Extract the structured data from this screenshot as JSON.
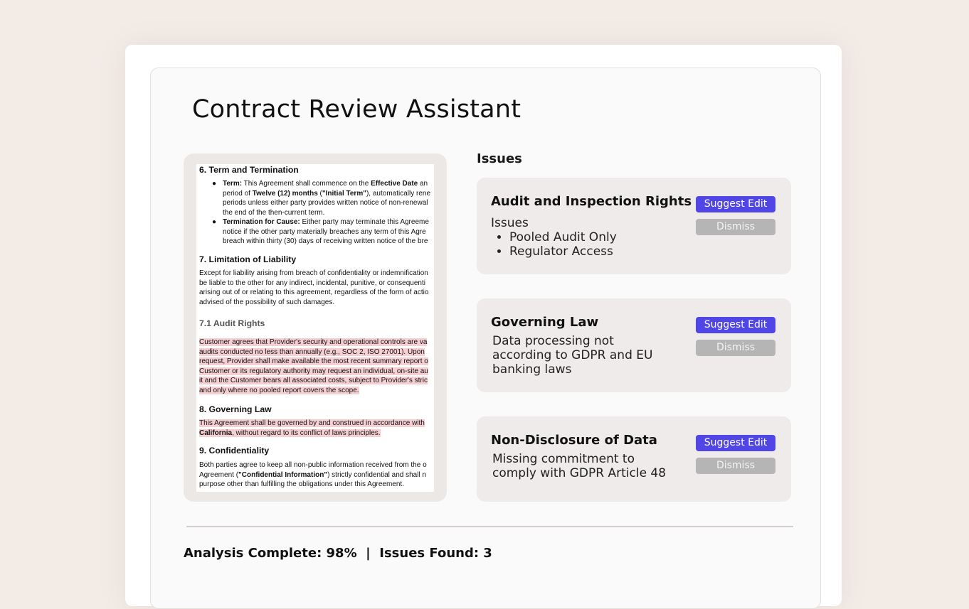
{
  "app": {
    "title": "Contract Review Assistant"
  },
  "document": {
    "sections": [
      {
        "heading": "6. Term and Termination"
      },
      {
        "heading": "7. Limitation of Liability"
      },
      {
        "heading": "7.1 Audit Rights"
      },
      {
        "heading": "8. Governing Law"
      },
      {
        "heading": "9. Confidentiality"
      }
    ],
    "term": {
      "b1_label": "Term:",
      "b1_l1a": " This Agreement shall commence on the ",
      "b1_l1b": "Effective Date",
      "b1_l1c": " an",
      "b1_l2a": "period of ",
      "b1_l2b": "Twelve (12) months",
      "b1_l2c": " (",
      "b1_l2d": "\"Initial Term\"",
      "b1_l2e": "), automatically rene",
      "b1_l3": "periods unless either party provides written notice of non-renewal",
      "b1_l4": "the end of the then-current term.",
      "b2_label": "Termination for Cause:",
      "b2_l1": " Either party may terminate this Agreeme",
      "b2_l2": "notice if the other party materially breaches any term of this Agre",
      "b2_l3": "breach within thirty (30) days of receiving written notice of the bre"
    },
    "liability_lines": [
      "Except for liability arising from breach of confidentiality or indemnification",
      "be liable to the other for any indirect, incidental, punitive, or consequenti",
      "arising out of or relating to this agreement, regardless of the form of actio",
      "advised of the possibility of such damages."
    ],
    "audit_lines": [
      "Customer agrees that Provider's security and operational controls are va",
      "audits conducted no less than annually (e.g., SOC 2, ISO 27001). Upon",
      "request, Provider shall make available the most recent summary report o",
      "Customer or its regulatory authority may request an individual, on-site au",
      "it and the Customer bears all associated costs, subject to Provider's stric",
      "and only where no pooled report covers the scope."
    ],
    "law": {
      "l1": "This Agreement shall be governed by and construed in accordance with",
      "l2a": "California",
      "l2b": ", without regard to its conflict of laws principles."
    },
    "conf": {
      "l1": "Both parties agree to keep all non-public information received from the o",
      "l2a": "Agreement (",
      "l2b": "\"Confidential Information\"",
      "l2c": ") strictly confidential and shall n",
      "l3": "purpose other than fulfilling the obligations under this Agreement."
    }
  },
  "issues_panel": {
    "heading": "Issues",
    "suggest_label": "Suggest Edit",
    "dismiss_label": "Dismiss",
    "items": [
      {
        "title": "Audit and Inspection Rights",
        "subtitle": "Issues",
        "bullets": [
          "Pooled Audit Only",
          "Regulator Access"
        ]
      },
      {
        "title": "Governing Law",
        "body": [
          "Data processing not",
          "according to GDPR and EU",
          "banking laws"
        ]
      },
      {
        "title": "Non-Disclosure of Data",
        "body": [
          "Missing commitment to",
          "comply with GDPR Article 48"
        ]
      }
    ]
  },
  "status": {
    "text": "Analysis Complete: 98%  |  Issues Found: 3"
  },
  "colors": {
    "accent": "#4f46e5",
    "dismiss": "#b5b5b5",
    "highlight": "#f6cfd3",
    "background": "#f3ebe6"
  }
}
